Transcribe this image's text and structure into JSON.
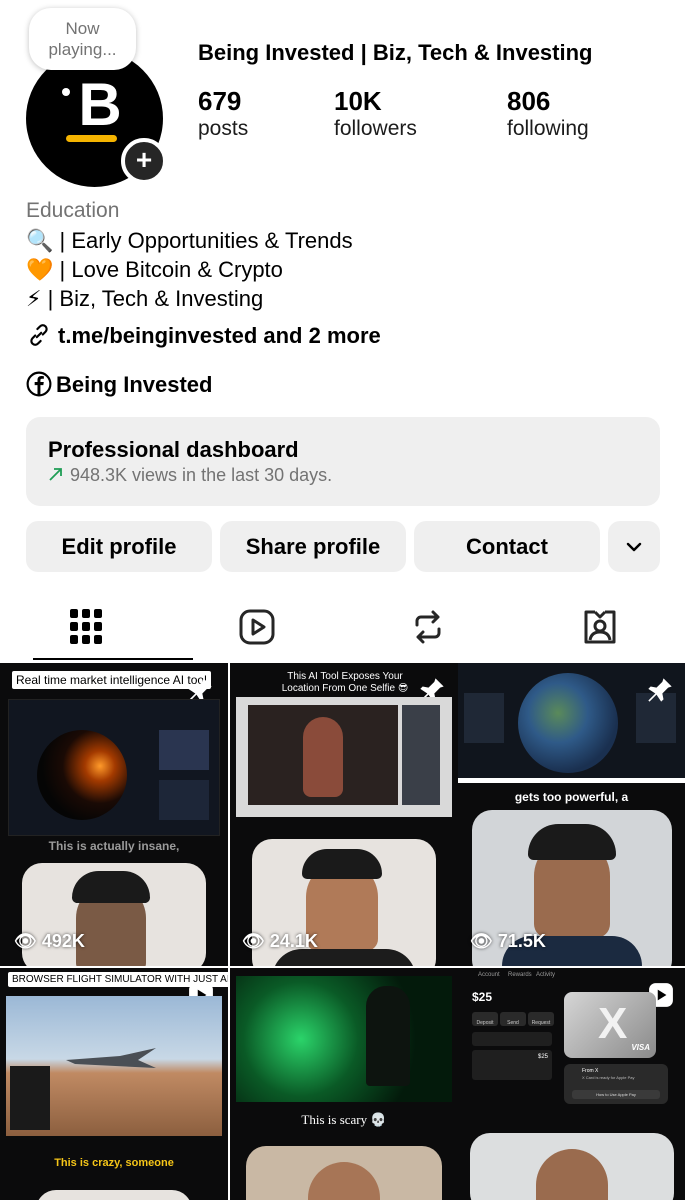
{
  "now_playing": "Now\nplaying...",
  "avatar_letter": "B",
  "profile": {
    "name": "Being Invested | Biz, Tech & Investing",
    "posts": {
      "value": "679",
      "label": "posts"
    },
    "followers": {
      "value": "10K",
      "label": "followers"
    },
    "following": {
      "value": "806",
      "label": "following"
    }
  },
  "bio": {
    "category": "Education",
    "lines": [
      {
        "emoji": "🔍",
        "text": "| Early Opportunities & Trends"
      },
      {
        "emoji": "🧡",
        "text": "| Love Bitcoin & Crypto"
      },
      {
        "emoji": "⚡",
        "text": "| Biz, Tech & Investing"
      }
    ],
    "link": "t.me/beinginvested and 2 more",
    "facebook": "Being Invested"
  },
  "dashboard": {
    "title": "Professional dashboard",
    "subtitle": "948.3K views in the last 30 days."
  },
  "buttons": {
    "edit": "Edit profile",
    "share": "Share profile",
    "contact": "Contact"
  },
  "tabs": [
    "grid-icon",
    "reels-icon",
    "reposts-icon",
    "tagged-icon"
  ],
  "grid": {
    "t1": {
      "caption": "Real time market intelligence AI tool",
      "subtitle": "This is actually insane,",
      "views": "492K"
    },
    "t2": {
      "caption": "This AI Tool Exposes Your Location From One Selfie 😎",
      "views": "24.1K"
    },
    "t3": {
      "subtitle": "gets too powerful, a",
      "views": "71.5K"
    },
    "t4": {
      "caption": "BROWSER FLIGHT SIMULATOR WITH JUST AI",
      "subtitle": "This is crazy, someone"
    },
    "t5": {
      "subtitle": "This is scary 💀"
    },
    "t6": {
      "tabs": [
        "Account",
        "Rewards",
        "Activity"
      ],
      "balance": "$25",
      "actions": [
        "Deposit",
        "Send",
        "Request"
      ],
      "card_brand": "VISA",
      "notif_from": "From X",
      "notif_text": "X Card is ready for Apple Pay",
      "notif_cta": "How to Use Apple Pay",
      "amount": "$25"
    }
  },
  "colors": {
    "accent_yellow": "#f5b400",
    "trend_green": "#1f9d55",
    "gray_btn": "#efefef"
  }
}
